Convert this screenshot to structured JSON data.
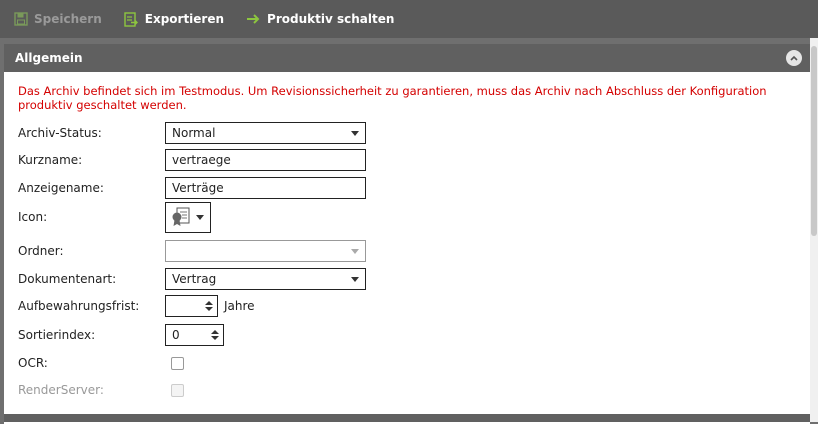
{
  "toolbar": {
    "save_label": "Speichern",
    "export_label": "Exportieren",
    "productive_label": "Produktiv schalten"
  },
  "panel": {
    "title": "Allgemein",
    "warning": "Das Archiv befindet sich im Testmodus. Um Revisionssicherheit zu garantieren, muss das Archiv nach Abschluss der Konfiguration produktiv geschaltet werden."
  },
  "form": {
    "archive_status": {
      "label": "Archiv-Status:",
      "value": "Normal"
    },
    "short_name": {
      "label": "Kurzname:",
      "value": "vertraege"
    },
    "display_name": {
      "label": "Anzeigename:",
      "value": "Verträge"
    },
    "icon": {
      "label": "Icon:"
    },
    "folder": {
      "label": "Ordner:",
      "value": ""
    },
    "document_type": {
      "label": "Dokumentenart:",
      "value": "Vertrag"
    },
    "retention": {
      "label": "Aufbewahrungsfrist:",
      "value": "",
      "unit": "Jahre"
    },
    "sort_index": {
      "label": "Sortierindex:",
      "value": "0"
    },
    "ocr": {
      "label": "OCR:",
      "checked": false
    },
    "render_server": {
      "label": "RenderServer:",
      "checked": false
    }
  },
  "colors": {
    "toolbar_bg": "#5a5a5a",
    "header_bg": "#606060",
    "warning": "#d40000",
    "accent_green": "#8dc63f"
  }
}
